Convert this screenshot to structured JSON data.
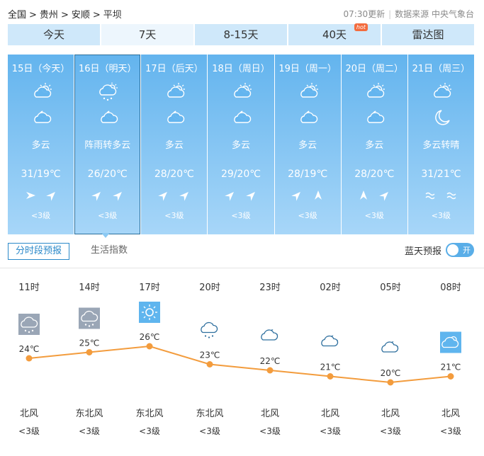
{
  "breadcrumb": [
    "全国",
    "贵州",
    "安顺",
    "平坝"
  ],
  "breadcrumb_sep": ">",
  "update_time": "07:30更新",
  "source": "数据来源 中央气象台",
  "tabs": [
    {
      "label": "今天"
    },
    {
      "label": "7天",
      "active": true
    },
    {
      "label": "8-15天"
    },
    {
      "label": "40天",
      "badge": "hot"
    },
    {
      "label": "雷达图"
    }
  ],
  "days": [
    {
      "date": "15日（今天）",
      "icon_day": "partly-cloudy",
      "icon_night": "cloudy-night",
      "desc": "多云",
      "temp": "31/19℃",
      "wind_dirs": [
        "east",
        "northeast"
      ],
      "level": "<3级"
    },
    {
      "date": "16日（明天）",
      "icon_day": "shower",
      "icon_night": "cloudy-night",
      "desc": "阵雨转多云",
      "temp": "26/20℃",
      "wind_dirs": [
        "northeast",
        "northeast"
      ],
      "level": "<3级",
      "selected": true
    },
    {
      "date": "17日（后天）",
      "icon_day": "partly-cloudy",
      "icon_night": "cloudy-night",
      "desc": "多云",
      "temp": "28/20℃",
      "wind_dirs": [
        "northeast",
        "northeast"
      ],
      "level": "<3级"
    },
    {
      "date": "18日（周日）",
      "icon_day": "partly-cloudy",
      "icon_night": "cloudy-night",
      "desc": "多云",
      "temp": "29/20℃",
      "wind_dirs": [
        "northeast",
        "northeast"
      ],
      "level": "<3级"
    },
    {
      "date": "19日（周一）",
      "icon_day": "partly-cloudy",
      "icon_night": "cloudy-night",
      "desc": "多云",
      "temp": "28/19℃",
      "wind_dirs": [
        "northeast",
        "north"
      ],
      "level": "<3级"
    },
    {
      "date": "20日（周二）",
      "icon_day": "partly-cloudy",
      "icon_night": "cloudy-night",
      "desc": "多云",
      "temp": "28/20℃",
      "wind_dirs": [
        "north",
        "northeast"
      ],
      "level": "<3级"
    },
    {
      "date": "21日（周三）",
      "icon_day": "partly-cloudy",
      "icon_night": "moon",
      "desc": "多云转晴",
      "temp": "31/21℃",
      "wind_dirs": [
        "calm",
        "calm"
      ],
      "level": "<3级"
    }
  ],
  "subtabs": [
    {
      "label": "分时段预报",
      "active": true
    },
    {
      "label": "生活指数"
    }
  ],
  "bluesky": {
    "label": "蓝天预报",
    "toggle_text": "开",
    "on": true
  },
  "hourly": [
    {
      "time": "11时",
      "temp": "24℃",
      "icon": "shower-box",
      "wind": "北风",
      "level": "<3级"
    },
    {
      "time": "14时",
      "temp": "25℃",
      "icon": "shower-box",
      "wind": "东北风",
      "level": "<3级"
    },
    {
      "time": "17时",
      "temp": "26℃",
      "icon": "sunny-box",
      "wind": "东北风",
      "level": "<3级"
    },
    {
      "time": "20时",
      "temp": "23℃",
      "icon": "shower-night",
      "wind": "东北风",
      "level": "<3级"
    },
    {
      "time": "23时",
      "temp": "22℃",
      "icon": "cloudy-night",
      "wind": "北风",
      "level": "<3级"
    },
    {
      "time": "02时",
      "temp": "21℃",
      "icon": "cloudy-night",
      "wind": "北风",
      "level": "<3级"
    },
    {
      "time": "05时",
      "temp": "20℃",
      "icon": "cloudy-night",
      "wind": "北风",
      "level": "<3级"
    },
    {
      "time": "08时",
      "temp": "21℃",
      "icon": "partly-cloudy-box",
      "wind": "北风",
      "level": "<3级"
    }
  ],
  "hourly_temp_values": [
    24,
    25,
    26,
    23,
    22,
    21,
    20,
    21
  ],
  "colors": {
    "accent": "#2b89c9",
    "card_top": "#63b4ee",
    "card_bottom": "#a7d6f8",
    "line": "#f39c3d",
    "tab_bg": "#cfe8fa",
    "hot": "#f36c3e"
  }
}
